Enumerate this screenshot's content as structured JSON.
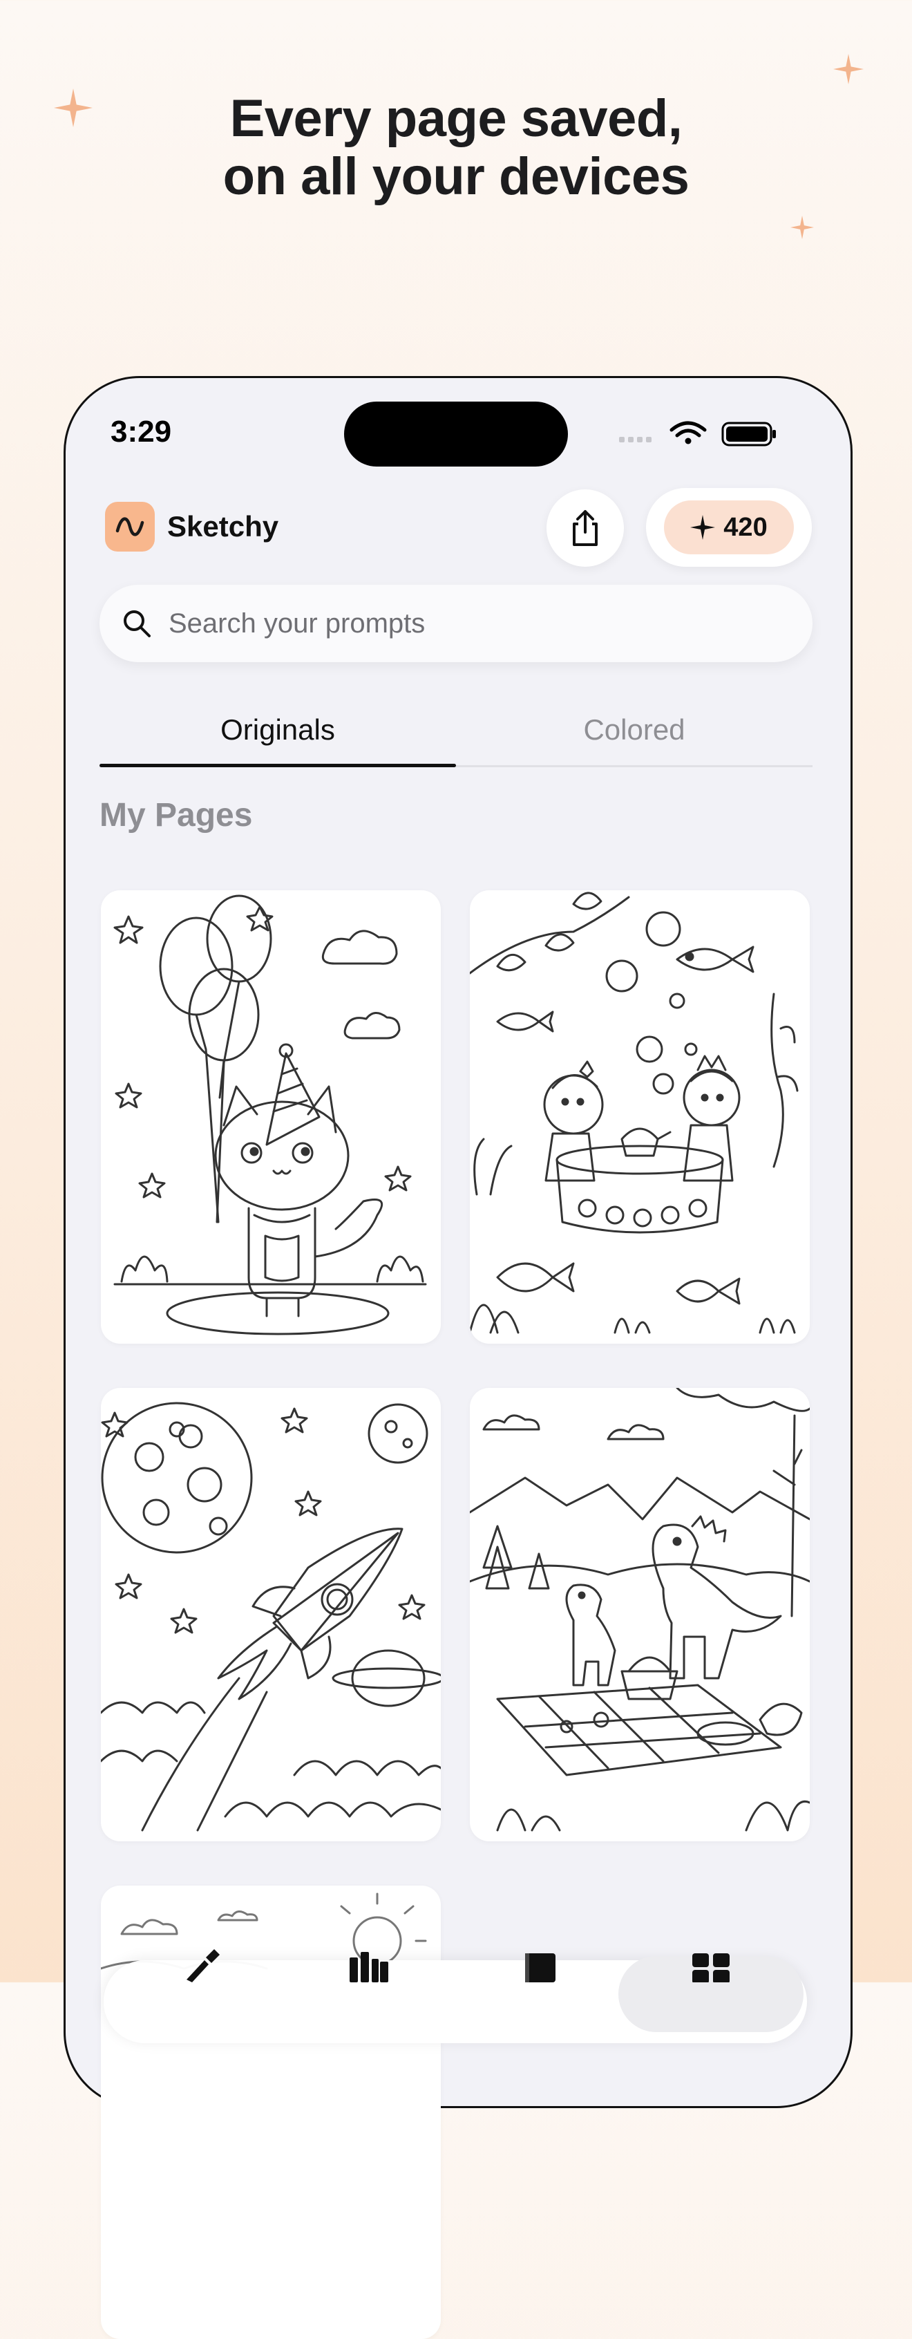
{
  "marketing": {
    "headline_line1": "Every page saved,",
    "headline_line2": "on all your devices"
  },
  "status_bar": {
    "time": "3:29"
  },
  "header": {
    "app_name": "Sketchy",
    "credits": "420"
  },
  "search": {
    "placeholder": "Search your prompts"
  },
  "tabs": [
    {
      "label": "Originals",
      "active": true
    },
    {
      "label": "Colored",
      "active": false
    }
  ],
  "section": {
    "title": "My Pages"
  },
  "pages": [
    {
      "subject": "kitten with party hat and balloons"
    },
    {
      "subject": "underwater tea party with fish"
    },
    {
      "subject": "rocket in space with moon and planets"
    },
    {
      "subject": "dinosaur picnic"
    },
    {
      "subject": "sunny sky scene"
    }
  ],
  "tab_bar": {
    "items": [
      {
        "icon": "brush-icon"
      },
      {
        "icon": "library-icon"
      },
      {
        "icon": "book-icon"
      },
      {
        "icon": "grid-icon",
        "active": true
      }
    ]
  },
  "colors": {
    "accent": "#f8b78d",
    "credit_pill": "#fbe0d1",
    "background": "#f2f2f7"
  }
}
